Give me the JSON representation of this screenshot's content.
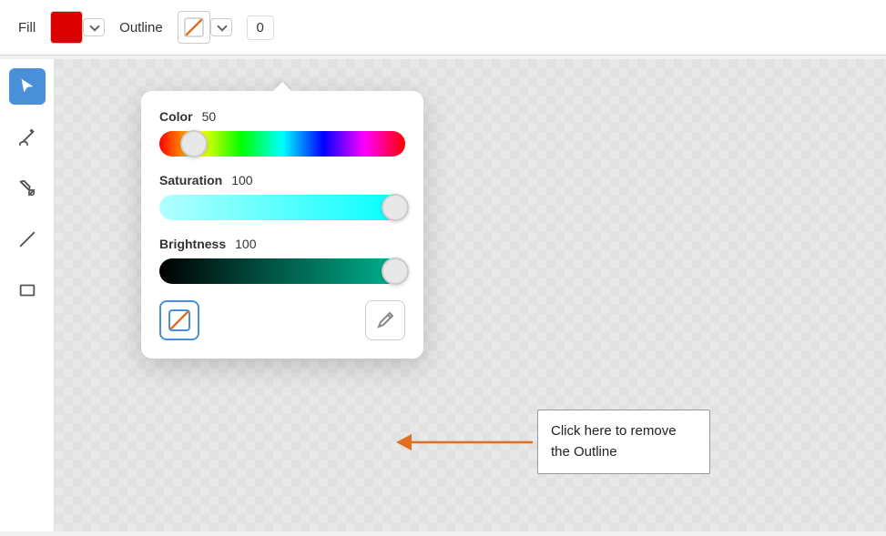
{
  "toolbar": {
    "fill_label": "Fill",
    "outline_label": "Outline",
    "outline_value": "0",
    "fill_color": "#dd0000"
  },
  "sidebar": {
    "tools": [
      {
        "name": "select",
        "label": "Select Tool",
        "active": true
      },
      {
        "name": "brush",
        "label": "Brush Tool",
        "active": false
      },
      {
        "name": "bucket",
        "label": "Paint Bucket Tool",
        "active": false
      },
      {
        "name": "line",
        "label": "Line Tool",
        "active": false
      },
      {
        "name": "rectangle",
        "label": "Rectangle Tool",
        "active": false
      }
    ]
  },
  "color_picker": {
    "title": "Color",
    "hue_label": "Color",
    "hue_value": "50",
    "saturation_label": "Saturation",
    "saturation_value": "100",
    "brightness_label": "Brightness",
    "brightness_value": "100",
    "hue_thumb_pct": 14,
    "saturation_thumb_pct": 96,
    "brightness_thumb_pct": 96
  },
  "annotation": {
    "text": "Click here to remove the Outline"
  }
}
